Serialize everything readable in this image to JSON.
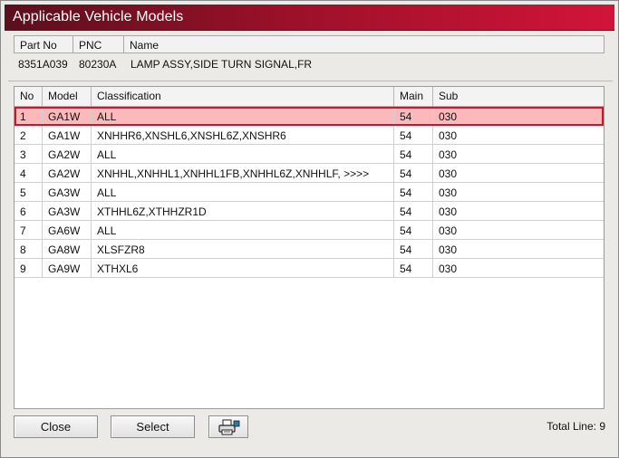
{
  "window": {
    "title": "Applicable Vehicle Models"
  },
  "part": {
    "headers": [
      "Part No",
      "PNC",
      "Name"
    ],
    "part_no": "8351A039",
    "pnc": "80230A",
    "name": "LAMP ASSY,SIDE TURN SIGNAL,FR"
  },
  "table": {
    "headers": [
      "No",
      "Model",
      "Classification",
      "Main",
      "Sub"
    ],
    "rows": [
      {
        "no": "1",
        "model": "GA1W",
        "classification": "ALL",
        "main": "54",
        "sub": "030"
      },
      {
        "no": "2",
        "model": "GA1W",
        "classification": "XNHHR6,XNSHL6,XNSHL6Z,XNSHR6",
        "main": "54",
        "sub": "030"
      },
      {
        "no": "3",
        "model": "GA2W",
        "classification": "ALL",
        "main": "54",
        "sub": "030"
      },
      {
        "no": "4",
        "model": "GA2W",
        "classification": "XNHHL,XNHHL1,XNHHL1FB,XNHHL6Z,XNHHLF,  >>>>",
        "main": "54",
        "sub": "030"
      },
      {
        "no": "5",
        "model": "GA3W",
        "classification": "ALL",
        "main": "54",
        "sub": "030"
      },
      {
        "no": "6",
        "model": "GA3W",
        "classification": "XTHHL6Z,XTHHZR1D",
        "main": "54",
        "sub": "030"
      },
      {
        "no": "7",
        "model": "GA6W",
        "classification": "ALL",
        "main": "54",
        "sub": "030"
      },
      {
        "no": "8",
        "model": "GA8W",
        "classification": "XLSFZR8",
        "main": "54",
        "sub": "030"
      },
      {
        "no": "9",
        "model": "GA9W",
        "classification": "XTHXL6",
        "main": "54",
        "sub": "030"
      }
    ],
    "selected_index": 0
  },
  "footer": {
    "close_label": "Close",
    "select_label": "Select",
    "print_icon": "printer-icon",
    "total_line": "Total Line: 9"
  },
  "colors": {
    "title_gradient_start": "#5a0f1e",
    "title_gradient_end": "#d2143a",
    "selected_row_bg": "#fcb9bb",
    "selected_row_border": "#c8182e"
  }
}
